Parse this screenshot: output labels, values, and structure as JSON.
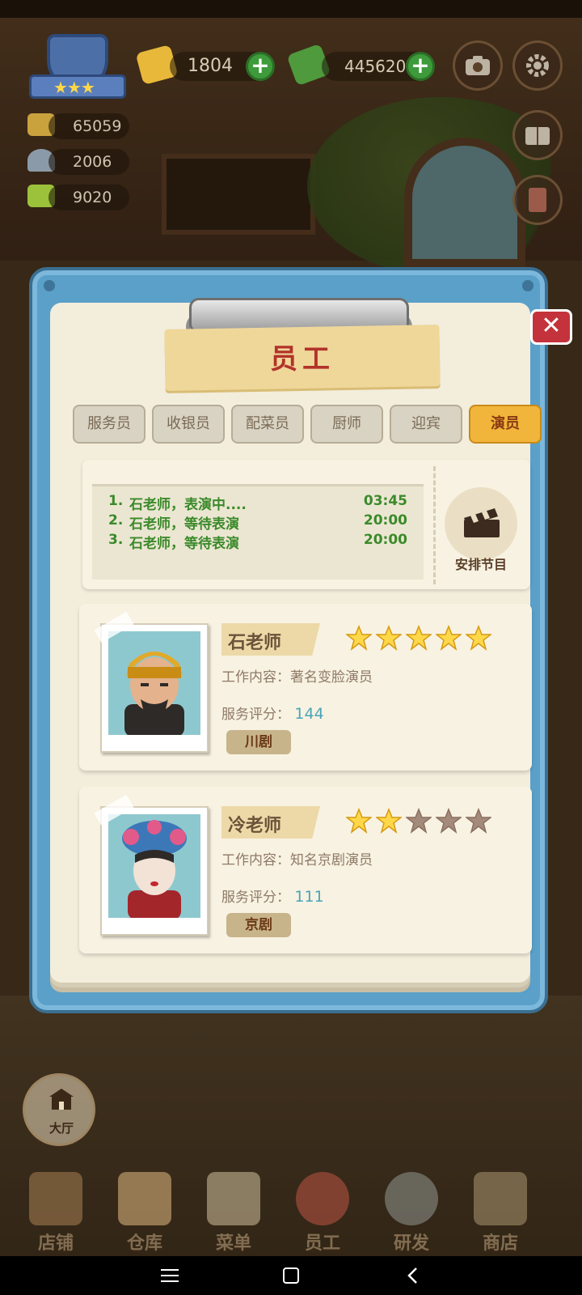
{
  "hud": {
    "gold": "1804",
    "cash": "445620",
    "stats": [
      "65059",
      "2006",
      "9020"
    ]
  },
  "modal": {
    "title": "员工",
    "tabs": [
      "服务员",
      "收银员",
      "配菜员",
      "厨师",
      "迎宾",
      "演员"
    ],
    "active_tab": 5,
    "schedule": [
      {
        "no": "1.",
        "text": "石老师，表演中....",
        "time": "03:45"
      },
      {
        "no": "2.",
        "text": "石老师，等待表演",
        "time": "20:00"
      },
      {
        "no": "3.",
        "text": "石老师，等待表演",
        "time": "20:00"
      }
    ],
    "arrange_label": "安排节目",
    "work_label": "工作内容：",
    "score_label": "服务评分：",
    "actors": [
      {
        "name": "石老师",
        "stars": 5,
        "work": "著名变脸演员",
        "score": "144",
        "genre": "川剧"
      },
      {
        "name": "冷老师",
        "stars": 2,
        "work": "知名京剧演员",
        "score": "111",
        "genre": "京剧"
      }
    ],
    "close_icon": "close-icon"
  },
  "hall_label": "大厅",
  "nav": [
    "店铺",
    "仓库",
    "菜单",
    "员工",
    "研发",
    "商店"
  ],
  "colors": {
    "accent_tab": "#f0b53a",
    "title_red": "#b2332a",
    "schedule_green": "#3b8a2a",
    "score_blue": "#4aa4b8",
    "star_gold": "#ffd84a"
  }
}
